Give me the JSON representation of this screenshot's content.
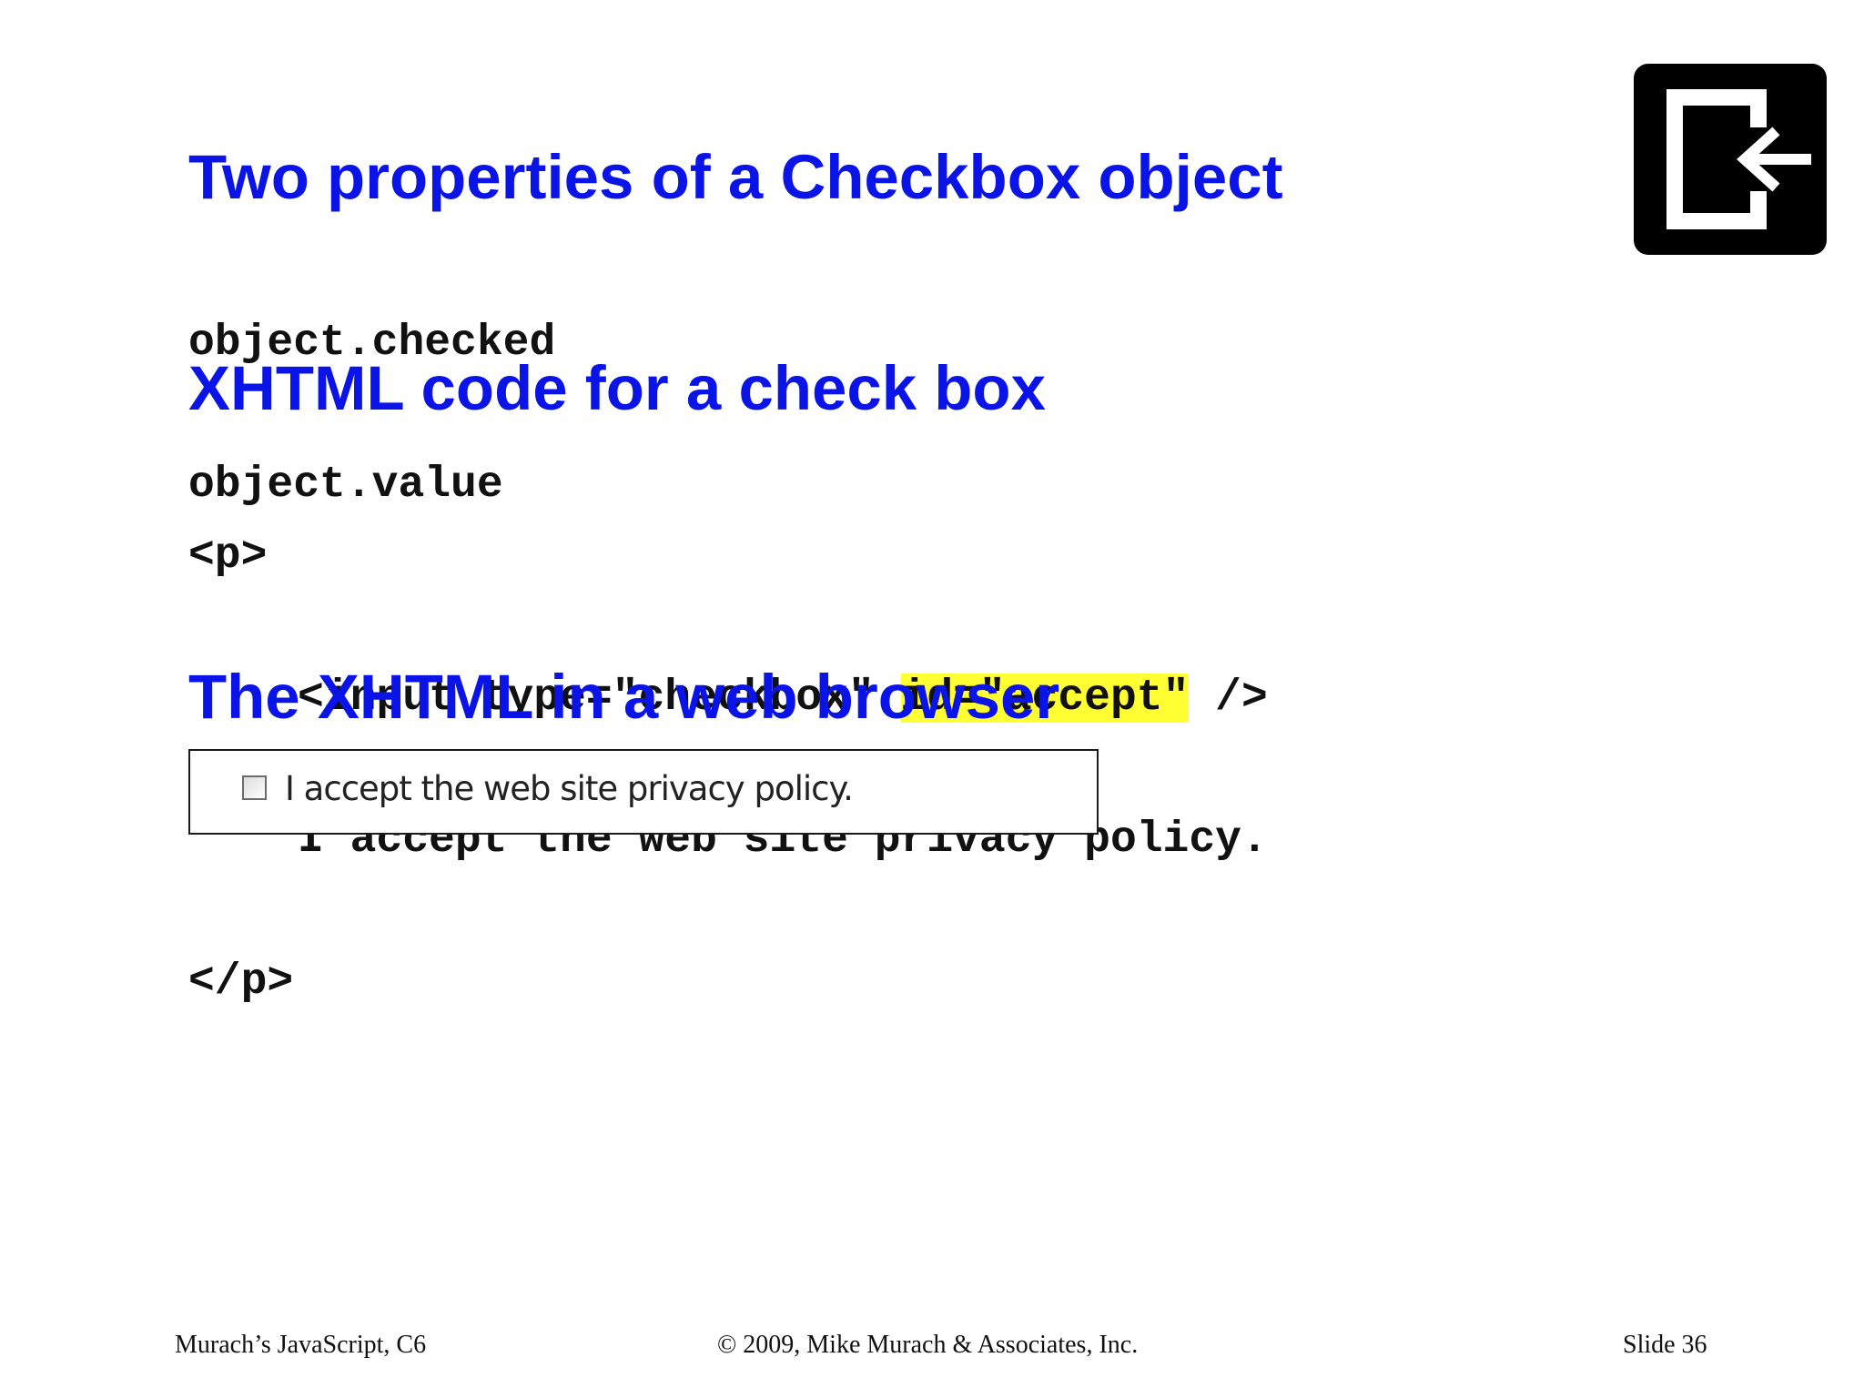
{
  "headings": {
    "properties": "Two properties of a Checkbox object",
    "xhtml_code": "XHTML code for a check box",
    "browser": "The XHTML in a web browser"
  },
  "properties_code": {
    "line1": "object.checked",
    "line2": "object.value"
  },
  "xhtml_code": {
    "line1": "<p>",
    "line2_before": "<input type=\"checkbox\" ",
    "line2_highlight": "id=\"accept\"",
    "line2_after": " />",
    "line3": "I accept the web site privacy policy.",
    "line4": "</p>",
    "highlight_color": "#ffff33"
  },
  "browser_preview": {
    "checkbox_checked": false,
    "label": "I accept the web site privacy policy."
  },
  "icon": "exit-door-arrow-icon",
  "colors": {
    "heading": "#0a14e6",
    "code": "#111111"
  },
  "footer": {
    "left": "Murach’s JavaScript, C6",
    "center": "© 2009, Mike Murach & Associates, Inc.",
    "right": "Slide 36"
  }
}
